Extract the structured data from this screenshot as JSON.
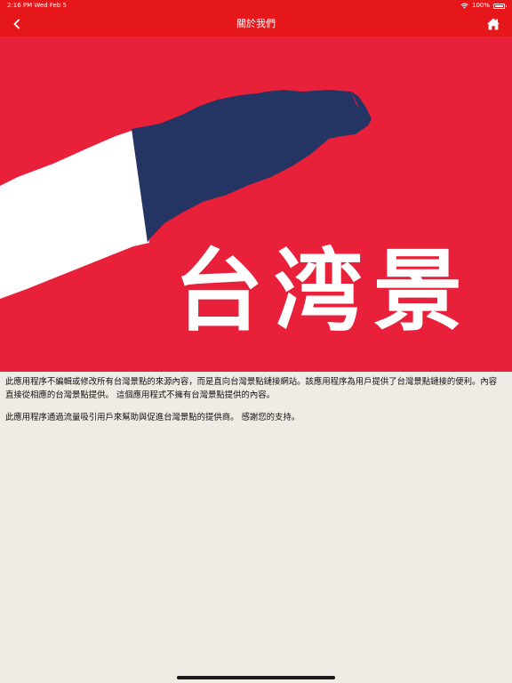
{
  "status_bar": {
    "time_date": "2:16 PM   Wed Feb 5",
    "battery": "100%",
    "battery_level": 1.0,
    "wifi_icon": "wifi-icon",
    "battery_icon": "battery-icon"
  },
  "nav": {
    "title": "關於我們",
    "back_icon": "chevron-left-icon",
    "home_icon": "home-icon"
  },
  "hero": {
    "banner_text": "台湾景",
    "colors": {
      "background": "#e8203a",
      "navy": "#243463",
      "white": "#ffffff"
    }
  },
  "content": {
    "paragraph_1": "此應用程序不編輯或修改所有台灣景點的來源內容，而是直向台灣景點鏈接網站。該應用程序為用戶提供了台灣景點鏈接的便利。內容直接從相應的台灣景點提供。 這個應用程式不擁有台灣景點提供的內容。",
    "paragraph_2": "此應用程序通過流量吸引用戶來幫助與促進台灣景點的提供商。 感謝您的支持。"
  },
  "colors": {
    "accent": "#e5171b",
    "page_background": "#efebe5"
  }
}
